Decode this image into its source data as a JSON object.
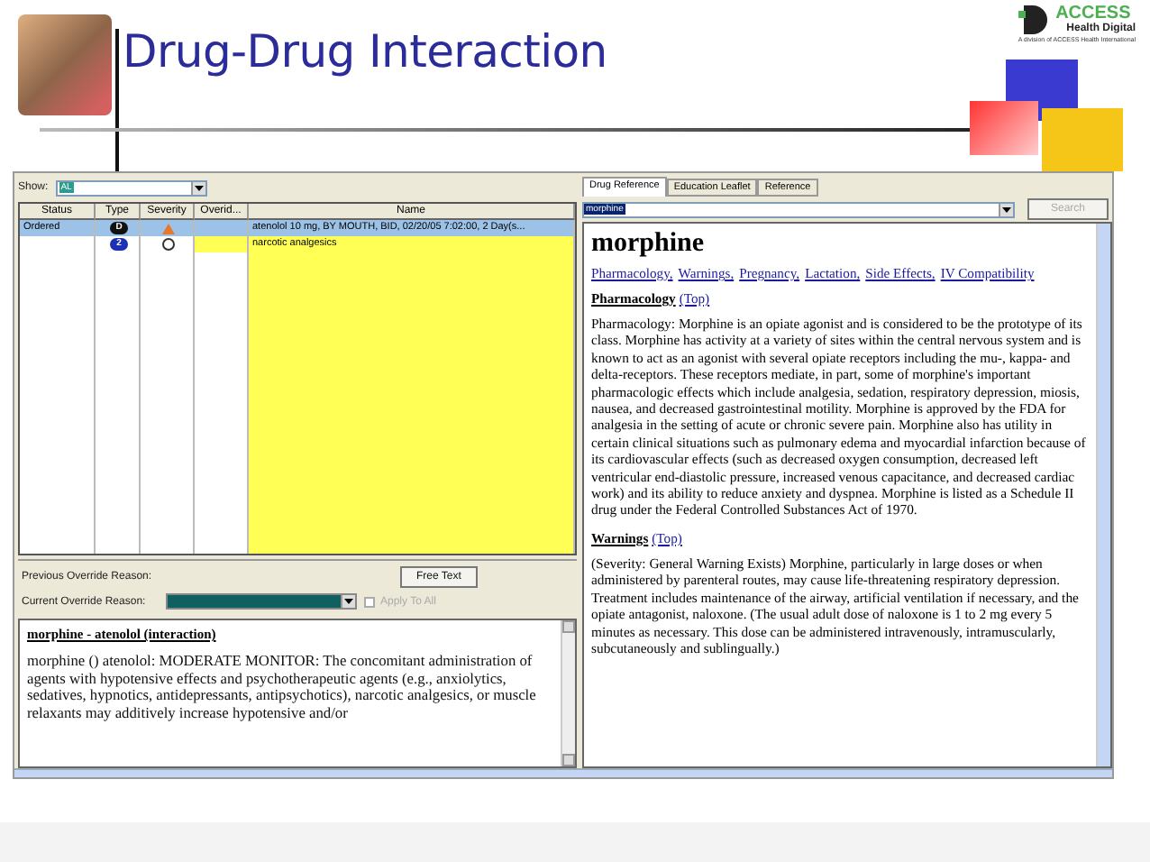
{
  "slide": {
    "title": "Drug-Drug Interaction",
    "logo": {
      "name": "ACCESS",
      "subtitle": "Health Digital",
      "tagline": "A division of ACCESS Health International"
    }
  },
  "left_panel": {
    "show": {
      "label": "Show:",
      "value": "AL"
    },
    "table": {
      "columns": [
        "Status",
        "Type",
        "Severity",
        "Overid...",
        "Name"
      ],
      "rows": [
        {
          "status": "Ordered",
          "type": "D",
          "color": "#111111",
          "kind": "triangle",
          "selected": true,
          "name": "atenolol 10 mg, BY MOUTH, BID, 02/20/05 7:02:00, 2 Day(s..."
        },
        {
          "type": "2",
          "color": "#1c2fb5",
          "kind": "circle",
          "selected": false,
          "name": "narcotic analgesics"
        }
      ]
    },
    "previous_override_reason": {
      "label": "Previous Override Reason:"
    },
    "free_text_button": "Free Text",
    "current_override_reason": {
      "label": "Current Override Reason:"
    },
    "apply_to_all": {
      "label": "Apply To All",
      "checked": false,
      "disabled": true
    },
    "interaction": {
      "title": "morphine - atenolol (interaction)",
      "text": "morphine () atenolol: MODERATE MONITOR: The concomitant administration of agents with hypotensive effects and psychotherapeutic agents (e.g., anxiolytics, sedatives, hypnotics, antidepressants, antipsychotics), narcotic analgesics, or muscle relaxants may additively increase hypotensive and/or"
    }
  },
  "right_panel": {
    "tabs": [
      {
        "label": "Drug Reference",
        "selected": true
      },
      {
        "label": "Education Leaflet",
        "selected": false
      },
      {
        "label": "Reference",
        "selected": false
      }
    ],
    "search": {
      "value": "morphine",
      "button": "Search",
      "button_disabled": true
    },
    "drug_title": "morphine",
    "links": [
      "Pharmacology,",
      "Warnings,",
      "Pregnancy,",
      "Lactation,",
      "Side Effects,",
      "IV Compatibility"
    ],
    "sections": [
      {
        "heading": "Pharmacology",
        "top_link": "(Top)",
        "text": "Pharmacology: Morphine is an opiate agonist and is considered to be the prototype of its class. Morphine has activity at a variety of sites within the central nervous system and is known to act as an agonist with several opiate receptors including the mu-, kappa- and delta-receptors. These receptors mediate, in part, some of morphine's important pharmacologic effects which include analgesia, sedation, respiratory depression, miosis, nausea, and decreased gastrointestinal motility. Morphine is approved by the FDA for analgesia in the setting of acute or chronic severe pain. Morphine also has utility in certain clinical situations such as pulmonary edema and myocardial infarction because of its cardiovascular effects (such as decreased oxygen consumption, decreased left ventricular end-diastolic pressure, increased venous capacitance, and decreased cardiac work) and its ability to reduce anxiety and dyspnea. Morphine is listed as a Schedule II drug under the Federal Controlled Substances Act of 1970."
      },
      {
        "heading": "Warnings",
        "top_link": "(Top)",
        "text": "(Severity: General Warning Exists) Morphine, particularly in large doses or when administered by parenteral routes, may cause life-threatening respiratory depression. Treatment includes maintenance of the airway, artificial ventilation if necessary, and the opiate antagonist, naloxone. (The usual adult dose of naloxone is 1 to 2 mg every 5 minutes as necessary. This dose can be administered intravenously, intramuscularly, subcutaneously and sublingually.)"
      }
    ]
  }
}
